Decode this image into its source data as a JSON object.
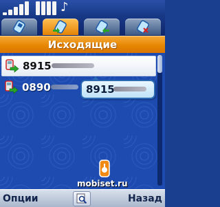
{
  "status": {
    "signal_icon": "signal-strength-icon",
    "battery_icon": "battery-icon",
    "music_icon": "music-note-icon"
  },
  "tabs": [
    {
      "icon": "all-calls-icon",
      "active": false
    },
    {
      "icon": "outgoing-call-icon",
      "active": true
    },
    {
      "icon": "incoming-call-icon",
      "active": false
    },
    {
      "icon": "missed-call-icon",
      "active": false
    }
  ],
  "header": {
    "title": "Исходящие"
  },
  "calls": [
    {
      "number": "8915",
      "selected": true,
      "icon": "outgoing-call-icon"
    },
    {
      "number": "0890",
      "selected": false,
      "icon": "outgoing-call-icon"
    }
  ],
  "tooltip": {
    "number": "8915"
  },
  "watermark": {
    "text": "mobiset.ru"
  },
  "softkeys": {
    "left": "Опции",
    "center_icon": "search-icon",
    "right": "Назад"
  },
  "colors": {
    "accent": "#e78703",
    "background": "#1d4bb0",
    "tooltip_border": "#2c6bb4"
  }
}
